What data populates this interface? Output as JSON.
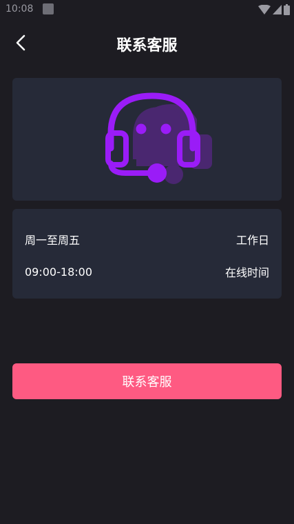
{
  "status_bar": {
    "time": "10:08",
    "icons": [
      "app-notification-icon",
      "wifi-icon",
      "signal-icon",
      "battery-icon"
    ]
  },
  "header": {
    "back_icon": "chevron-left-icon",
    "title": "联系客服"
  },
  "hero": {
    "icon": "headset-support-icon",
    "accent_color": "#9a1cf7"
  },
  "info": {
    "rows": [
      {
        "left": "周一至周五",
        "right": "工作日"
      },
      {
        "left": "09:00-18:00",
        "right": "在线时间"
      }
    ]
  },
  "contact_button": {
    "label": "联系客服",
    "color": "#fe5a82"
  },
  "colors": {
    "background": "#1d1c22",
    "card": "#262a38",
    "text": "#ffffff"
  }
}
